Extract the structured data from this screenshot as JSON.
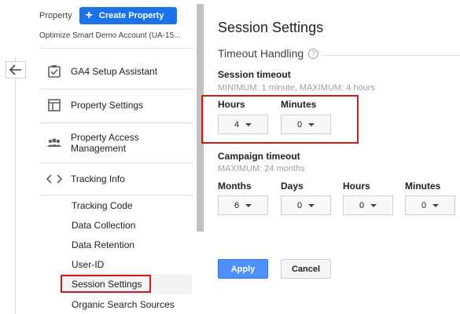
{
  "header": {
    "property_label": "Property",
    "create_label": "Create Property",
    "account_name": "Optimize Smart Demo Account (UA-15..."
  },
  "nav": {
    "items": [
      {
        "label": "GA4 Setup Assistant",
        "icon": "checkbox-icon"
      },
      {
        "label": "Property Settings",
        "icon": "layout-icon"
      },
      {
        "label": "Property Access Management",
        "icon": "people-icon"
      },
      {
        "label": "Tracking Info",
        "icon": "code-icon"
      }
    ],
    "sub_items": [
      {
        "label": "Tracking Code"
      },
      {
        "label": "Data Collection"
      },
      {
        "label": "Data Retention"
      },
      {
        "label": "User-ID"
      },
      {
        "label": "Session Settings",
        "active": true
      },
      {
        "label": "Organic Search Sources"
      }
    ]
  },
  "main": {
    "title": "Session Settings",
    "section_title": "Timeout Handling",
    "session_timeout": {
      "label": "Session timeout",
      "hint": "MINIMUM: 1 minute, MAXIMUM: 4 hours",
      "hours_label": "Hours",
      "hours_value": "4",
      "minutes_label": "Minutes",
      "minutes_value": "0"
    },
    "campaign_timeout": {
      "label": "Campaign timeout",
      "hint": "MAXIMUM: 24 months",
      "months_label": "Months",
      "months_value": "6",
      "days_label": "Days",
      "days_value": "0",
      "hours_label": "Hours",
      "hours_value": "0",
      "minutes_label": "Minutes",
      "minutes_value": "0"
    },
    "apply_label": "Apply",
    "cancel_label": "Cancel"
  },
  "colors": {
    "accent": "#1a73e8",
    "apply": "#4d90fe",
    "highlight": "#cc1b1b"
  }
}
